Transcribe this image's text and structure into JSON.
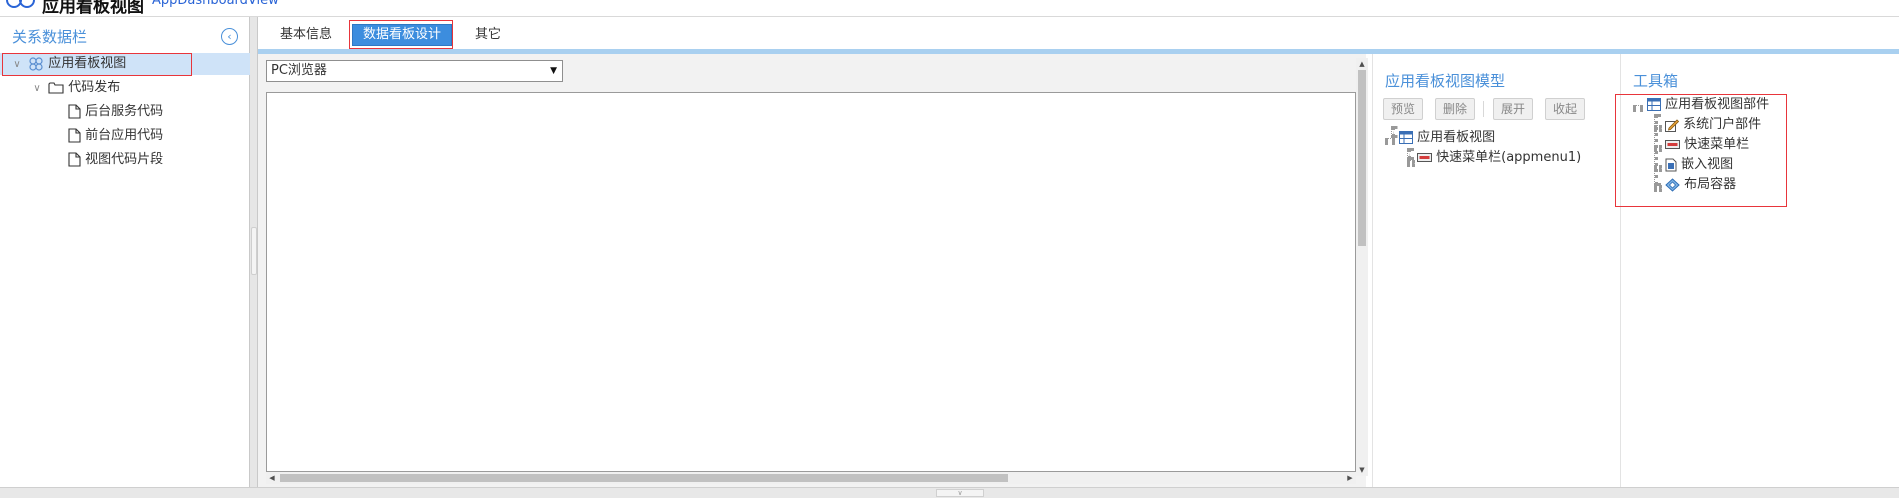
{
  "header": {
    "title": "应用看板视图",
    "subtitle": "AppDashboardView"
  },
  "sidebar": {
    "title": "关系数据栏",
    "tree": {
      "root": "应用看板视图",
      "folder": "代码发布",
      "files": [
        "后台服务代码",
        "前台应用代码",
        "视图代码片段"
      ]
    }
  },
  "tabs": [
    "基本信息",
    "数据看板设计",
    "其它"
  ],
  "active_tab": "数据看板设计",
  "design": {
    "device_select": "PC浏览器"
  },
  "model_panel": {
    "title": "应用看板视图模型",
    "buttons": [
      "预览",
      "删除",
      "展开",
      "收起"
    ],
    "tree": {
      "root": "应用看板视图",
      "child": "快速菜单栏(appmenu1)"
    }
  },
  "toolbox": {
    "title": "工具箱",
    "root": "应用看板视图部件",
    "items": [
      "系统门户部件",
      "快速菜单栏",
      "嵌入视图",
      "布局容器"
    ]
  },
  "colors": {
    "accent": "#4a90d9",
    "active_tab": "#3c8dde",
    "highlight_border": "#e8353b",
    "selection": "#cfe3f8"
  }
}
